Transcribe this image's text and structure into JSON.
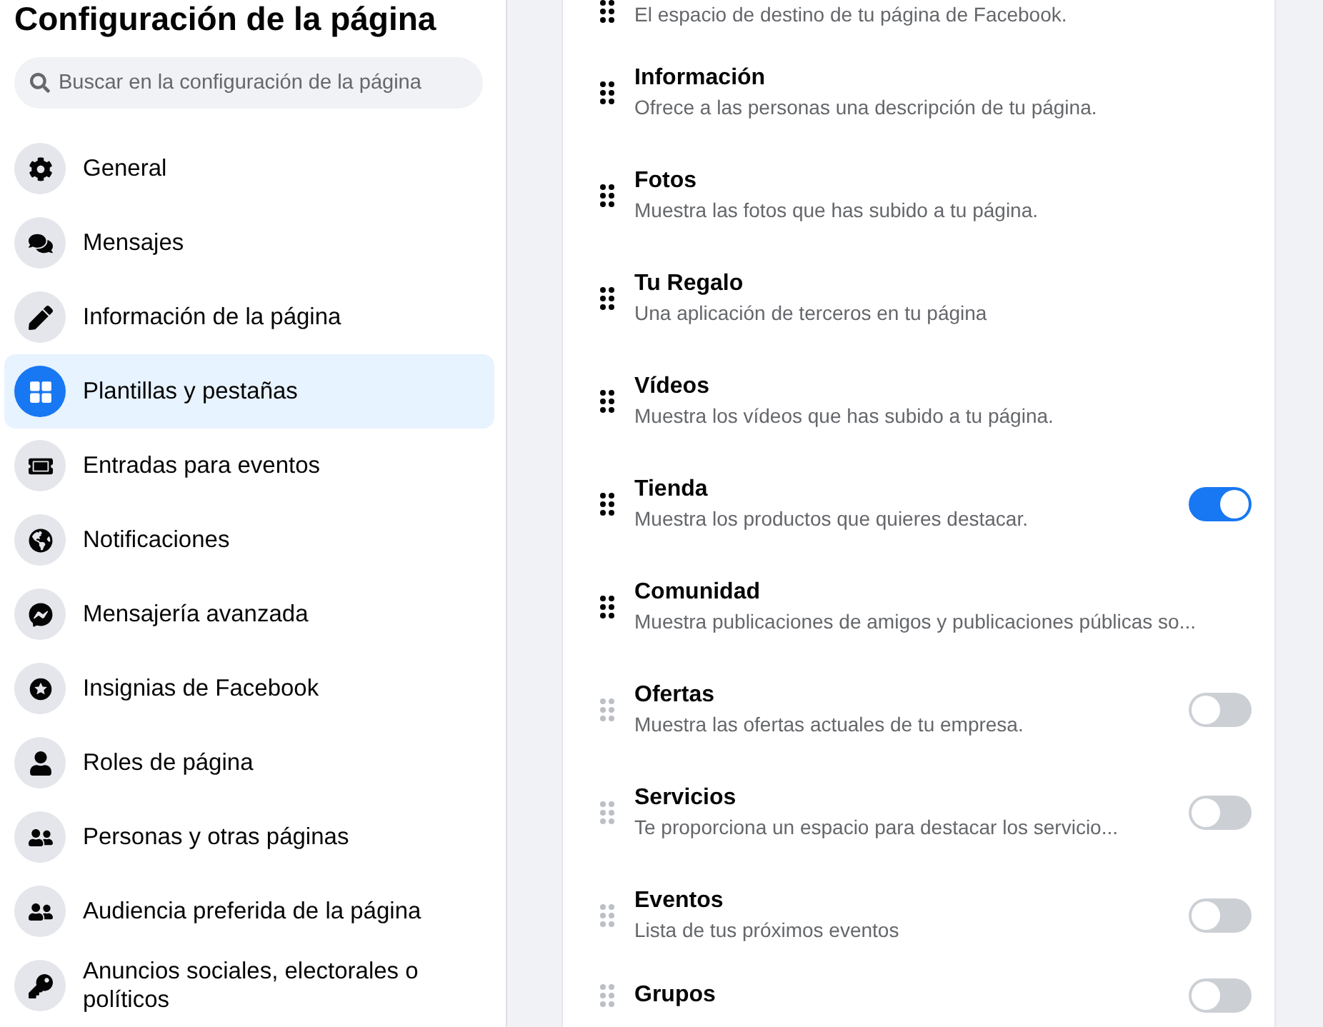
{
  "sidebar": {
    "title": "Configuración de la página",
    "search": {
      "placeholder": "Buscar en la configuración de la página"
    },
    "items": [
      {
        "label": "General",
        "selected": false
      },
      {
        "label": "Mensajes",
        "selected": false
      },
      {
        "label": "Información de la página",
        "selected": false
      },
      {
        "label": "Plantillas y pestañas",
        "selected": true
      },
      {
        "label": "Entradas para eventos",
        "selected": false
      },
      {
        "label": "Notificaciones",
        "selected": false
      },
      {
        "label": "Mensajería avanzada",
        "selected": false
      },
      {
        "label": "Insignias de Facebook",
        "selected": false
      },
      {
        "label": "Roles de página",
        "selected": false
      },
      {
        "label": "Personas y otras páginas",
        "selected": false
      },
      {
        "label": "Audiencia preferida de la página",
        "selected": false
      },
      {
        "label": "Anuncios sociales, electorales o políticos",
        "selected": false
      }
    ]
  },
  "tabs": [
    {
      "kind": "plain",
      "description": "El espacio de destino de tu página de Facebook.",
      "enabled": true
    },
    {
      "kind": "plain",
      "title": "Información",
      "description": "Ofrece a las personas una descripción de tu página.",
      "enabled": true
    },
    {
      "kind": "plain",
      "title": "Fotos",
      "description": "Muestra las fotos que has subido a tu página.",
      "enabled": true
    },
    {
      "kind": "plain",
      "title": "Tu Regalo",
      "description": "Una aplicación de terceros en tu página",
      "enabled": true
    },
    {
      "kind": "plain",
      "title": "Vídeos",
      "description": "Muestra los vídeos que has subido a tu página.",
      "enabled": true
    },
    {
      "kind": "toggle",
      "title": "Tienda",
      "description": "Muestra los productos que quieres destacar.",
      "enabled": true,
      "on": true
    },
    {
      "kind": "plain",
      "title": "Comunidad",
      "description": "Muestra publicaciones de amigos y publicaciones públicas so...",
      "enabled": true
    },
    {
      "kind": "toggle",
      "title": "Ofertas",
      "description": "Muestra las ofertas actuales de tu empresa.",
      "enabled": false,
      "on": false
    },
    {
      "kind": "toggle",
      "title": "Servicios",
      "description": "Te proporciona un espacio para destacar los servicio...",
      "enabled": false,
      "on": false
    },
    {
      "kind": "toggle",
      "title": "Eventos",
      "description": "Lista de tus próximos eventos",
      "enabled": false,
      "on": false
    },
    {
      "kind": "toggle",
      "title": "Grupos",
      "enabled": false,
      "on": false
    }
  ]
}
